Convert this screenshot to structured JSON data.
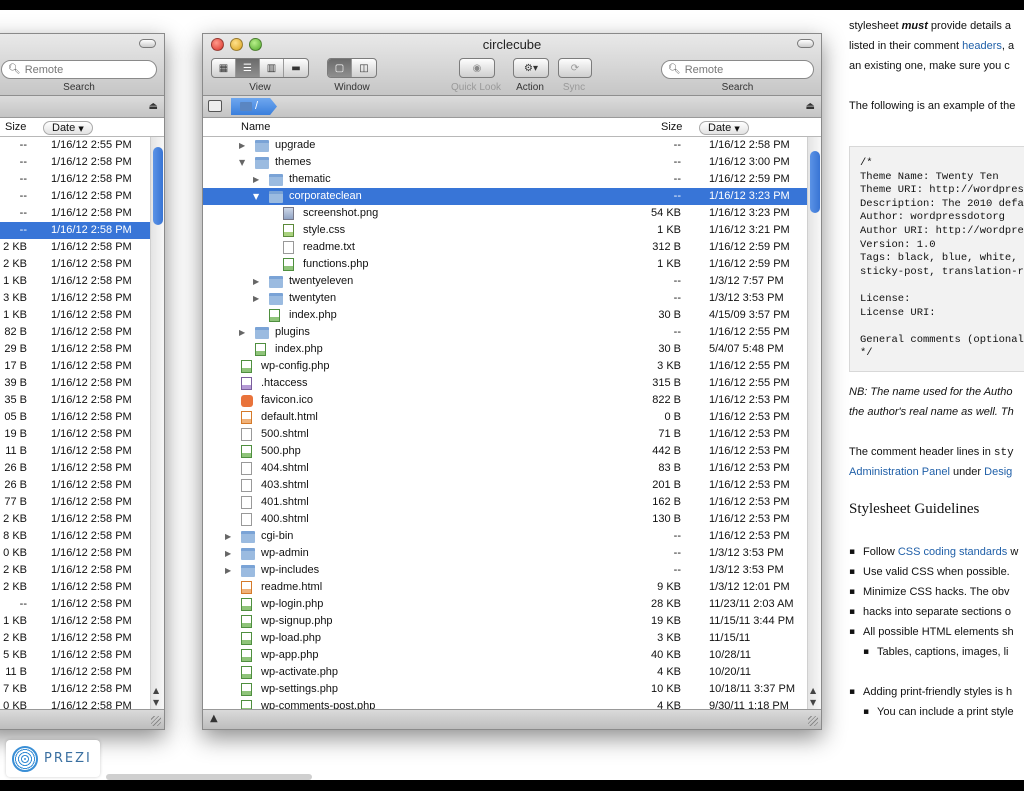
{
  "left_window": {
    "search_placeholder": "Remote",
    "search_label": "Search",
    "columns": {
      "size": "Size",
      "date": "Date"
    },
    "rows": [
      {
        "size": "--",
        "date": "1/16/12 2:55 PM"
      },
      {
        "size": "--",
        "date": "1/16/12 2:58 PM"
      },
      {
        "size": "--",
        "date": "1/16/12 2:58 PM"
      },
      {
        "size": "--",
        "date": "1/16/12 2:58 PM"
      },
      {
        "size": "--",
        "date": "1/16/12 2:58 PM"
      },
      {
        "size": "--",
        "date": "1/16/12 2:58 PM",
        "selected": true
      },
      {
        "size": "2 KB",
        "date": "1/16/12 2:58 PM"
      },
      {
        "size": "2 KB",
        "date": "1/16/12 2:58 PM"
      },
      {
        "size": "1 KB",
        "date": "1/16/12 2:58 PM"
      },
      {
        "size": "3 KB",
        "date": "1/16/12 2:58 PM"
      },
      {
        "size": "1 KB",
        "date": "1/16/12 2:58 PM"
      },
      {
        "size": "82 B",
        "date": "1/16/12 2:58 PM"
      },
      {
        "size": "29 B",
        "date": "1/16/12 2:58 PM"
      },
      {
        "size": "17 B",
        "date": "1/16/12 2:58 PM"
      },
      {
        "size": "39 B",
        "date": "1/16/12 2:58 PM"
      },
      {
        "size": "35 B",
        "date": "1/16/12 2:58 PM"
      },
      {
        "size": "05 B",
        "date": "1/16/12 2:58 PM"
      },
      {
        "size": "19 B",
        "date": "1/16/12 2:58 PM"
      },
      {
        "size": "11 B",
        "date": "1/16/12 2:58 PM"
      },
      {
        "size": "26 B",
        "date": "1/16/12 2:58 PM"
      },
      {
        "size": "26 B",
        "date": "1/16/12 2:58 PM"
      },
      {
        "size": "77 B",
        "date": "1/16/12 2:58 PM"
      },
      {
        "size": "2 KB",
        "date": "1/16/12 2:58 PM"
      },
      {
        "size": "8 KB",
        "date": "1/16/12 2:58 PM"
      },
      {
        "size": "0 KB",
        "date": "1/16/12 2:58 PM"
      },
      {
        "size": "2 KB",
        "date": "1/16/12 2:58 PM"
      },
      {
        "size": "2 KB",
        "date": "1/16/12 2:58 PM"
      },
      {
        "size": "--",
        "date": "1/16/12 2:58 PM"
      },
      {
        "size": "1 KB",
        "date": "1/16/12 2:58 PM"
      },
      {
        "size": "2 KB",
        "date": "1/16/12 2:58 PM"
      },
      {
        "size": "5 KB",
        "date": "1/16/12 2:58 PM"
      },
      {
        "size": "11 B",
        "date": "1/16/12 2:58 PM"
      },
      {
        "size": "7 KB",
        "date": "1/16/12 2:58 PM"
      },
      {
        "size": "0 KB",
        "date": "1/16/12 2:58 PM"
      }
    ]
  },
  "main_window": {
    "title": "circlecube",
    "toolbar": {
      "view": "View",
      "window": "Window",
      "quick_look": "Quick Look",
      "action": "Action",
      "sync": "Sync",
      "search_placeholder": "Remote",
      "search_label": "Search"
    },
    "path": "/",
    "columns": {
      "name": "Name",
      "size": "Size",
      "date": "Date"
    },
    "rows": [
      {
        "depth": 0,
        "tri": "▶",
        "icon": "folder",
        "name": "upgrade",
        "size": "--",
        "date": "1/16/12 2:58 PM"
      },
      {
        "depth": 0,
        "tri": "▼",
        "icon": "folder",
        "name": "themes",
        "size": "--",
        "date": "1/16/12 3:00 PM"
      },
      {
        "depth": 1,
        "tri": "▶",
        "icon": "folder",
        "name": "thematic",
        "size": "--",
        "date": "1/16/12 2:59 PM"
      },
      {
        "depth": 1,
        "tri": "▼",
        "icon": "folder",
        "name": "corporateclean",
        "size": "--",
        "date": "1/16/12 3:23 PM",
        "selected": true
      },
      {
        "depth": 2,
        "tri": "",
        "icon": "img",
        "name": "screenshot.png",
        "size": "54 KB",
        "date": "1/16/12 3:23 PM"
      },
      {
        "depth": 2,
        "tri": "",
        "icon": "css",
        "name": "style.css",
        "size": "1 KB",
        "date": "1/16/12 3:21 PM"
      },
      {
        "depth": 2,
        "tri": "",
        "icon": "file",
        "name": "readme.txt",
        "size": "312 B",
        "date": "1/16/12 2:59 PM"
      },
      {
        "depth": 2,
        "tri": "",
        "icon": "php",
        "name": "functions.php",
        "size": "1 KB",
        "date": "1/16/12 2:59 PM"
      },
      {
        "depth": 1,
        "tri": "▶",
        "icon": "folder",
        "name": "twentyeleven",
        "size": "--",
        "date": "1/3/12 7:57 PM"
      },
      {
        "depth": 1,
        "tri": "▶",
        "icon": "folder",
        "name": "twentyten",
        "size": "--",
        "date": "1/3/12 3:53 PM"
      },
      {
        "depth": 1,
        "tri": "",
        "icon": "php",
        "name": "index.php",
        "size": "30 B",
        "date": "4/15/09 3:57 PM"
      },
      {
        "depth": 0,
        "tri": "▶",
        "icon": "folder",
        "name": "plugins",
        "size": "--",
        "date": "1/16/12 2:55 PM"
      },
      {
        "depth": 0,
        "tri": "",
        "icon": "php",
        "name": "index.php",
        "size": "30 B",
        "date": "5/4/07 5:48 PM"
      },
      {
        "depth": -1,
        "tri": "",
        "icon": "php",
        "name": "wp-config.php",
        "size": "3 KB",
        "date": "1/16/12 2:55 PM"
      },
      {
        "depth": -1,
        "tri": "",
        "icon": "ht",
        "name": ".htaccess",
        "size": "315 B",
        "date": "1/16/12 2:55 PM"
      },
      {
        "depth": -1,
        "tri": "",
        "icon": "fav",
        "name": "favicon.ico",
        "size": "822 B",
        "date": "1/16/12 2:53 PM"
      },
      {
        "depth": -1,
        "tri": "",
        "icon": "html",
        "name": "default.html",
        "size": "0 B",
        "date": "1/16/12 2:53 PM"
      },
      {
        "depth": -1,
        "tri": "",
        "icon": "file",
        "name": "500.shtml",
        "size": "71 B",
        "date": "1/16/12 2:53 PM"
      },
      {
        "depth": -1,
        "tri": "",
        "icon": "php",
        "name": "500.php",
        "size": "442 B",
        "date": "1/16/12 2:53 PM"
      },
      {
        "depth": -1,
        "tri": "",
        "icon": "file",
        "name": "404.shtml",
        "size": "83 B",
        "date": "1/16/12 2:53 PM"
      },
      {
        "depth": -1,
        "tri": "",
        "icon": "file",
        "name": "403.shtml",
        "size": "201 B",
        "date": "1/16/12 2:53 PM"
      },
      {
        "depth": -1,
        "tri": "",
        "icon": "file",
        "name": "401.shtml",
        "size": "162 B",
        "date": "1/16/12 2:53 PM"
      },
      {
        "depth": -1,
        "tri": "",
        "icon": "file",
        "name": "400.shtml",
        "size": "130 B",
        "date": "1/16/12 2:53 PM"
      },
      {
        "depth": -1,
        "tri": "▶",
        "icon": "folder",
        "name": "cgi-bin",
        "size": "--",
        "date": "1/16/12 2:53 PM"
      },
      {
        "depth": -1,
        "tri": "▶",
        "icon": "folder",
        "name": "wp-admin",
        "size": "--",
        "date": "1/3/12 3:53 PM"
      },
      {
        "depth": -1,
        "tri": "▶",
        "icon": "folder",
        "name": "wp-includes",
        "size": "--",
        "date": "1/3/12 3:53 PM"
      },
      {
        "depth": -1,
        "tri": "",
        "icon": "html",
        "name": "readme.html",
        "size": "9 KB",
        "date": "1/3/12 12:01 PM"
      },
      {
        "depth": -1,
        "tri": "",
        "icon": "php",
        "name": "wp-login.php",
        "size": "28 KB",
        "date": "11/23/11 2:03 AM"
      },
      {
        "depth": -1,
        "tri": "",
        "icon": "php",
        "name": "wp-signup.php",
        "size": "19 KB",
        "date": "11/15/11 3:44 PM"
      },
      {
        "depth": -1,
        "tri": "",
        "icon": "php",
        "name": "wp-load.php",
        "size": "3 KB",
        "date": "11/15/11"
      },
      {
        "depth": -1,
        "tri": "",
        "icon": "php",
        "name": "wp-app.php",
        "size": "40 KB",
        "date": "10/28/11"
      },
      {
        "depth": -1,
        "tri": "",
        "icon": "php",
        "name": "wp-activate.php",
        "size": "4 KB",
        "date": "10/20/11"
      },
      {
        "depth": -1,
        "tri": "",
        "icon": "php",
        "name": "wp-settings.php",
        "size": "10 KB",
        "date": "10/18/11 3:37 PM"
      },
      {
        "depth": -1,
        "tri": "",
        "icon": "php",
        "name": "wp-comments-post.php",
        "size": "4 KB",
        "date": "9/30/11 1:18 PM"
      }
    ]
  },
  "doc": {
    "line1_a": "stylesheet ",
    "line1_b": "must",
    "line1_c": " provide details a",
    "line2_a": "listed in their comment ",
    "line2_link": "headers",
    "line2_b": ", a",
    "line3": "an existing one, make sure you c",
    "line4": "The following is an example of the",
    "code": "/*\nTheme Name: Twenty Ten\nTheme URI: http://wordpres\nDescription: The 2010 defa\nAuthor: wordpressdotorg\nAuthor URI: http://wordpre\nVersion: 1.0\nTags: black, blue, white, \nsticky-post, translation-r\n\nLicense:\nLicense URI:\n\nGeneral comments (optional\n*/",
    "nb1": "NB: The name used for the Autho",
    "nb2": "the author's real name as well. Th",
    "p2_a": "The comment header lines in ",
    "p2_code": "sty",
    "p3_link1": "Administration Panel",
    "p3_mid": " under ",
    "p3_link2": "Desig",
    "heading": "Stylesheet Guidelines",
    "li1_a": "Follow ",
    "li1_link": "CSS coding standards",
    "li1_b": " w",
    "li2": "Use valid CSS when possible.",
    "li3": "Minimize CSS hacks. The obv",
    "li3b": "hacks into separate sections o",
    "li4": "All possible HTML elements sh",
    "li5": "Tables, captions, images, li",
    "li6": "Adding print-friendly styles is h",
    "li7": "You can include a print style"
  },
  "prezi": {
    "label": "PREZI"
  },
  "colors": {
    "selection": "#3875d7",
    "link": "#1f5fa8",
    "prezi": "#3a8fd6"
  }
}
